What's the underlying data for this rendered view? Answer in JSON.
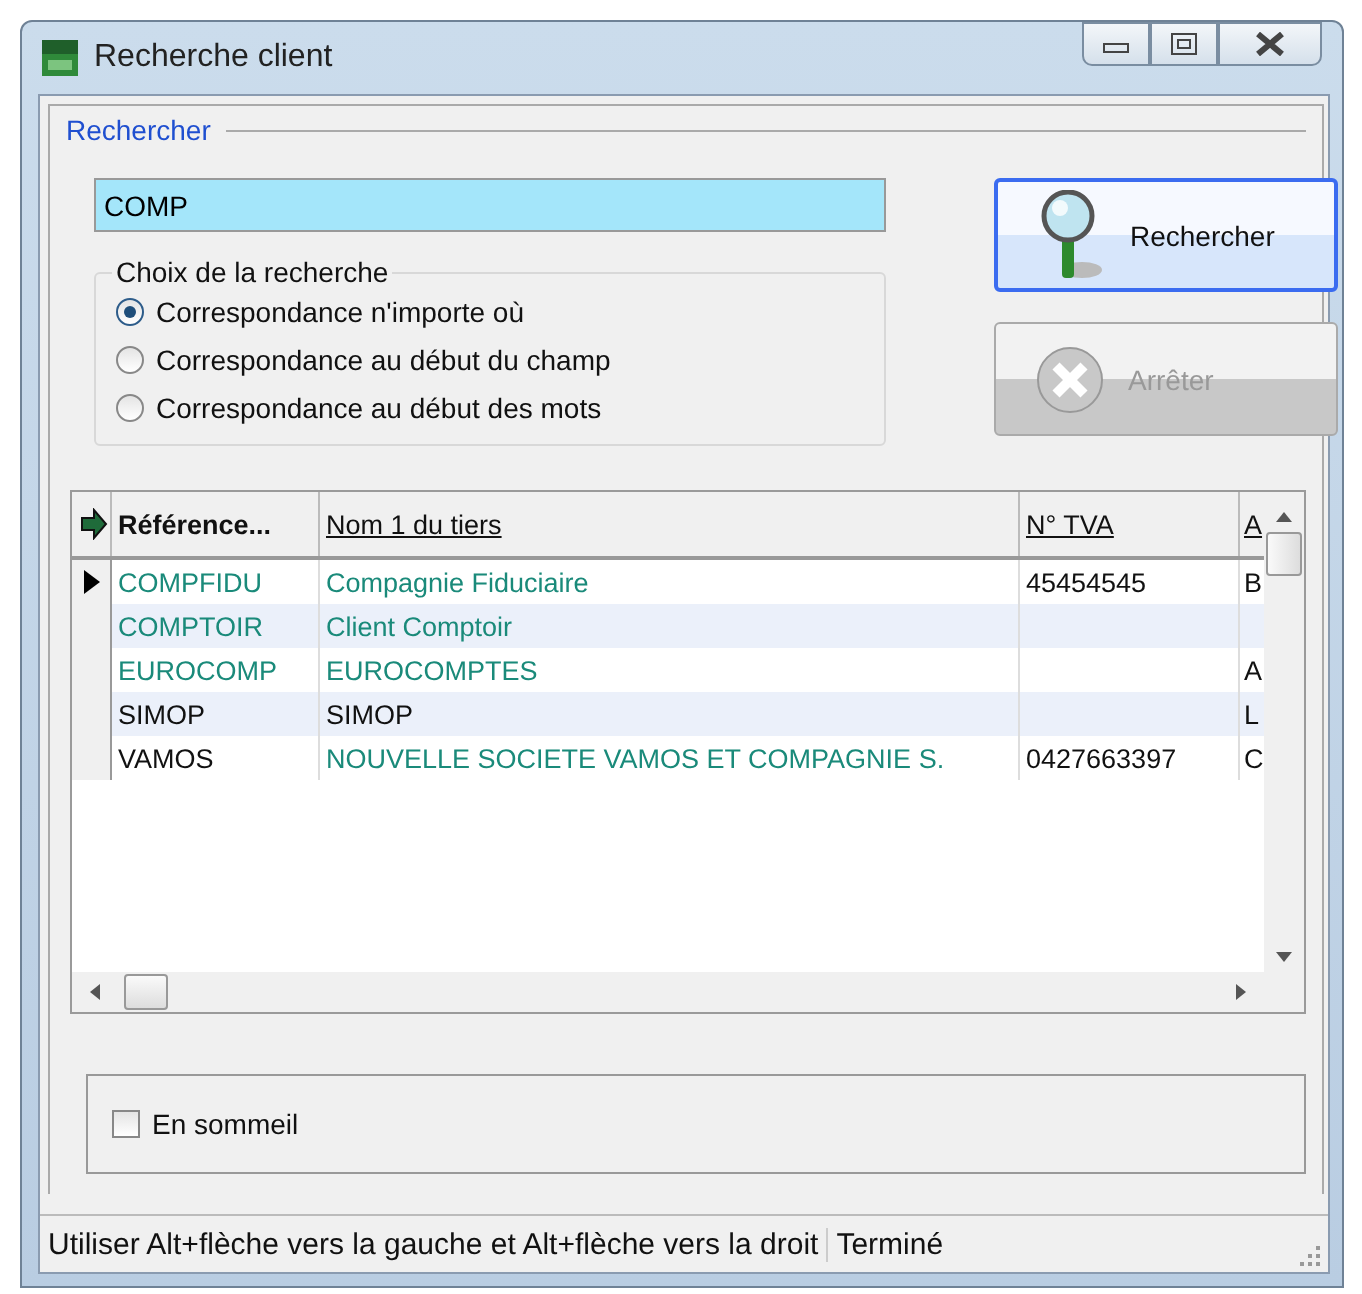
{
  "window": {
    "title": "Recherche client"
  },
  "search_group": {
    "title": "Rechercher",
    "query": "COMP"
  },
  "search_mode": {
    "title": "Choix de la recherche",
    "options": [
      {
        "label": "Correspondance n'importe où",
        "selected": true
      },
      {
        "label": "Correspondance au début du champ",
        "selected": false
      },
      {
        "label": "Correspondance au début des mots",
        "selected": false
      }
    ]
  },
  "buttons": [
    {
      "label": "Rechercher",
      "kind": "search",
      "disabled": false
    },
    {
      "label": "Arrêter",
      "kind": "stop",
      "disabled": true
    }
  ],
  "table": {
    "columns": [
      {
        "label": "Référence...",
        "bold": true
      },
      {
        "label": "Nom 1 du tiers",
        "bold": false
      },
      {
        "label": "N° TVA",
        "bold": false
      },
      {
        "label": "A",
        "bold": false
      }
    ],
    "rows": [
      {
        "selected": true,
        "cells": [
          {
            "text": "COMPFIDU",
            "color": "#1a8a7a"
          },
          {
            "text": "Compagnie Fiduciaire",
            "color": "#1a8a7a"
          },
          {
            "text": "45454545",
            "color": "#111111"
          },
          {
            "text": "B",
            "color": "#111111"
          }
        ]
      },
      {
        "selected": false,
        "cells": [
          {
            "text": "COMPTOIR",
            "color": "#1a8a7a"
          },
          {
            "text": "Client Comptoir",
            "color": "#1a8a7a"
          },
          null,
          null
        ]
      },
      {
        "selected": false,
        "cells": [
          {
            "text": "EUROCOMP",
            "color": "#1a8a7a"
          },
          {
            "text": "EUROCOMPTES",
            "color": "#1a8a7a"
          },
          null,
          {
            "text": "A",
            "color": "#111111"
          }
        ]
      },
      {
        "selected": false,
        "cells": [
          {
            "text": "SIMOP",
            "color": "#111111"
          },
          {
            "text": "SIMOP",
            "color": "#111111"
          },
          null,
          {
            "text": "L",
            "color": "#111111"
          }
        ]
      },
      {
        "selected": false,
        "cells": [
          {
            "text": "VAMOS",
            "color": "#111111"
          },
          {
            "text": "NOUVELLE SOCIETE VAMOS ET COMPAGNIE S.",
            "color": "#1a8a7a"
          },
          {
            "text": "0427663397",
            "color": "#111111"
          },
          {
            "text": "C",
            "color": "#111111"
          }
        ]
      }
    ]
  },
  "sleep": {
    "label": "En sommeil",
    "checked": false
  },
  "status_bar": {
    "message": "Utiliser Alt+flèche vers la gauche et Alt+flèche vers la droit",
    "state": "Terminé"
  }
}
